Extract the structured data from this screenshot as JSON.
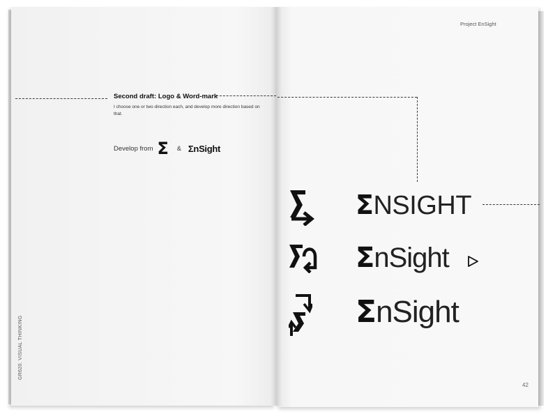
{
  "left_page": {
    "heading": "Second draft: Logo & Word-mark",
    "description": "I choose one or two direction each, and develop more direction based on that.",
    "develop_label": "Develop from",
    "sigma_symbol": "Σ",
    "ampersand": "&",
    "mini_wordmark": "ΣnSight",
    "spine_text": "GR620. VISUAL THINKING"
  },
  "right_page": {
    "header": "Project EnSight",
    "page_number": "42",
    "wordmarks": [
      {
        "sigma": "Σ",
        "rest": "NSIGHT"
      },
      {
        "sigma": "Σ",
        "rest": "nSight"
      },
      {
        "sigma": "Σ",
        "rest": "nSight"
      }
    ],
    "logo_icons": [
      "sigma-arrow-icon",
      "sigma-loop-arrow-icon",
      "sigma-cycle-arrow-icon"
    ],
    "extra_icon": "play-triangle-icon"
  }
}
